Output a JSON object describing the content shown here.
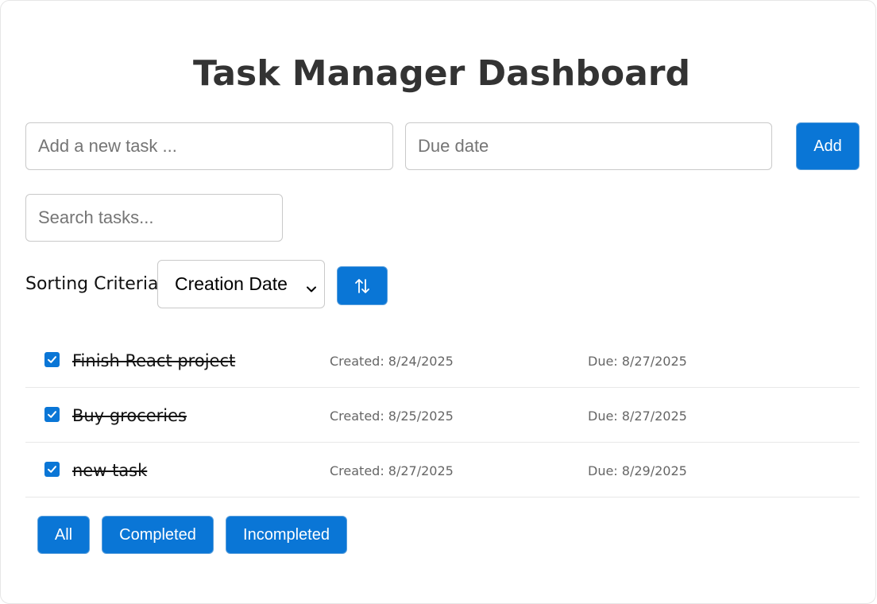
{
  "header": {
    "title": "Task Manager Dashboard"
  },
  "form": {
    "task_placeholder": "Add a new task ...",
    "due_placeholder": "Due date",
    "add_label": "Add"
  },
  "search": {
    "placeholder": "Search tasks..."
  },
  "sorting": {
    "label": "Sorting Criteria",
    "selected": "Creation Date",
    "toggle_icon": "sort-arrows-icon"
  },
  "tasks": [
    {
      "name": "Finish React project",
      "created": "Created: 8/24/2025",
      "due": "Due: 8/27/2025",
      "completed": true
    },
    {
      "name": "Buy groceries",
      "created": "Created: 8/25/2025",
      "due": "Due: 8/27/2025",
      "completed": true
    },
    {
      "name": "new task",
      "created": "Created: 8/27/2025",
      "due": "Due: 8/29/2025",
      "completed": true
    }
  ],
  "filters": {
    "all": "All",
    "completed": "Completed",
    "incompleted": "Incompleted"
  },
  "colors": {
    "accent": "#0a76d6",
    "title": "#333333",
    "meta_text": "#666666"
  }
}
